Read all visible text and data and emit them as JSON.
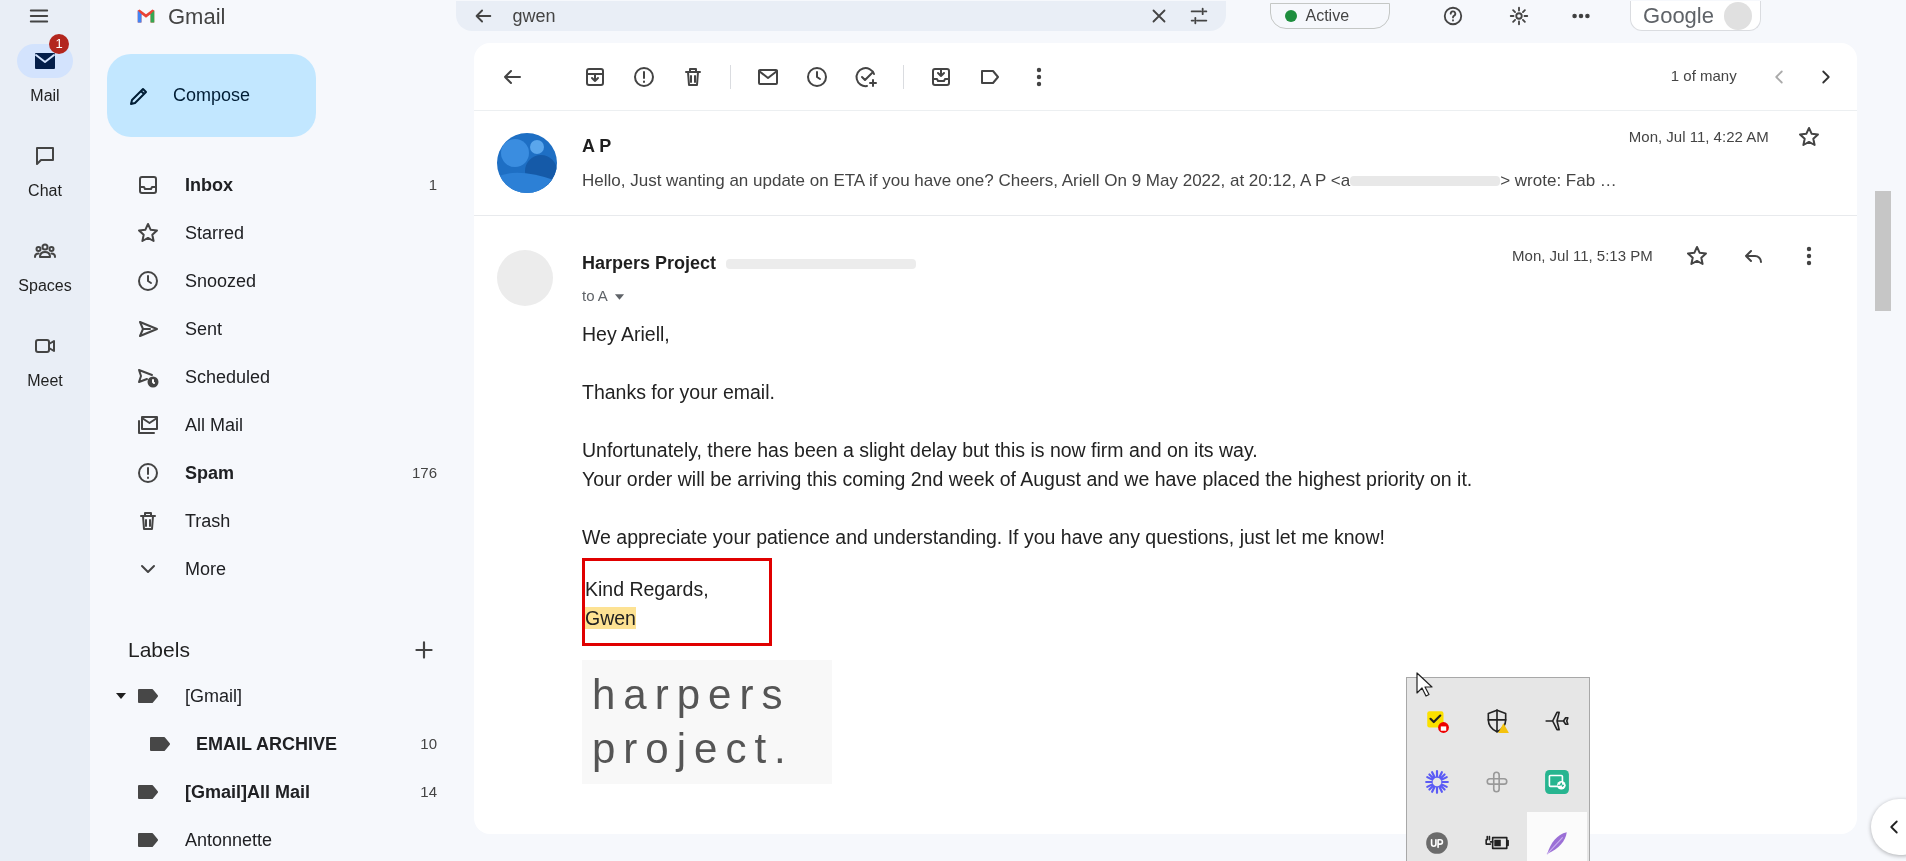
{
  "topbar": {
    "app_name": "Gmail",
    "search": {
      "value": "gwen"
    },
    "status": "Active",
    "account_text": "Google"
  },
  "rail": [
    {
      "label": "Mail",
      "selected": true,
      "badge": "1"
    },
    {
      "label": "Chat",
      "selected": false
    },
    {
      "label": "Spaces",
      "selected": false
    },
    {
      "label": "Meet",
      "selected": false
    }
  ],
  "compose": "Compose",
  "folders": [
    {
      "label": "Inbox",
      "count": "1",
      "bold": true
    },
    {
      "label": "Starred",
      "bold": false
    },
    {
      "label": "Snoozed",
      "bold": false
    },
    {
      "label": "Sent",
      "bold": false
    },
    {
      "label": "Scheduled",
      "bold": false
    },
    {
      "label": "All Mail",
      "bold": false
    },
    {
      "label": "Spam",
      "count": "176",
      "bold": true
    },
    {
      "label": "Trash",
      "bold": false
    },
    {
      "label": "More",
      "bold": false
    }
  ],
  "labels": {
    "title": "Labels",
    "items": [
      {
        "label": "[Gmail]",
        "bold": false,
        "expanded": true,
        "children": [
          {
            "label": "EMAIL ARCHIVE",
            "count": "10",
            "bold": true
          }
        ]
      },
      {
        "label": "[Gmail]All Mail",
        "count": "14",
        "bold": true
      },
      {
        "label": "Antonnette",
        "bold": false
      }
    ]
  },
  "toolbar": {
    "pager": "1 of many"
  },
  "messages": [
    {
      "kind": "collapsed",
      "sender": "A P",
      "date": "Mon, Jul 11, 4:22 AM",
      "starred": false,
      "snippet_start": "Hello, Just wanting an update on ETA if you have one? Cheers, Ariell On 9 May 2022, at 20:12, A P <a",
      "snippet_end": "> wrote: Fab …"
    },
    {
      "kind": "expanded",
      "sender": "Harpers Project",
      "recipient": "to A",
      "date": "Mon, Jul 11, 5:13 PM",
      "starred": false,
      "paragraphs": [
        [
          "Hey Ariell,"
        ],
        [
          "Thanks for your email."
        ],
        [
          "Unfortunately, there has been a slight delay but this is now firm and on its way.",
          "Your order will be arriving this coming 2nd week of August and we have placed the highest priority on it."
        ],
        [
          "We appreciate your patience and understanding. If you have any questions, just let me know!"
        ]
      ],
      "signature": [
        {
          "text": "Kind Regards,",
          "highlighted": false
        },
        {
          "text": "Gwen",
          "highlighted": true
        }
      ],
      "logo": [
        "harpers",
        "project."
      ]
    }
  ],
  "tray": {
    "items": [
      {
        "highlighted": false
      },
      {
        "highlighted": false
      },
      {
        "highlighted": false
      },
      {
        "highlighted": false
      },
      {
        "highlighted": false
      },
      {
        "highlighted": false
      },
      {
        "highlighted": false
      },
      {
        "highlighted": false
      },
      {
        "highlighted": true
      }
    ]
  }
}
